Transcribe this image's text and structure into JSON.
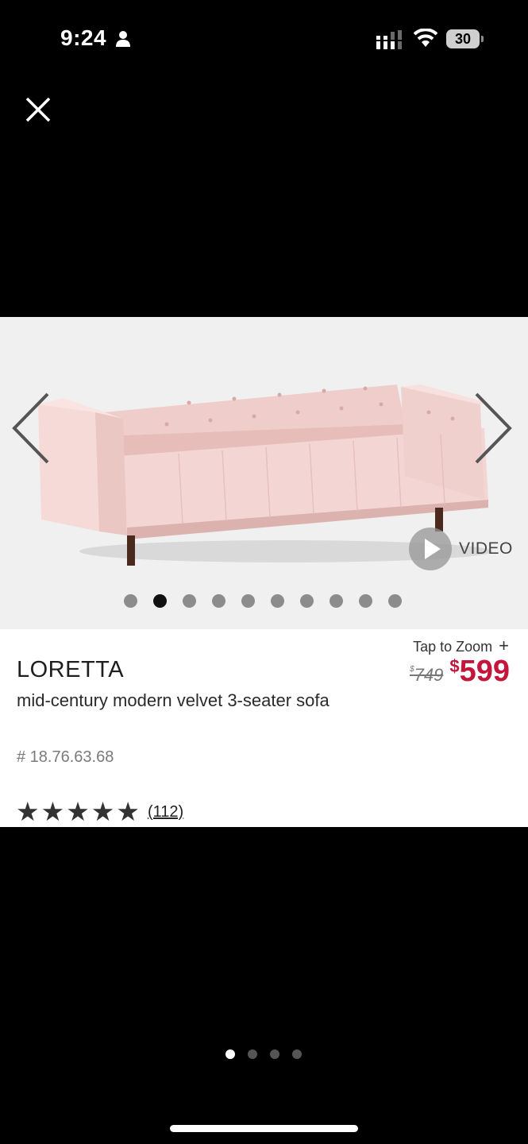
{
  "status_bar": {
    "time": "9:24",
    "battery": "30"
  },
  "product": {
    "brand": "LORETTA",
    "name": "mid-century modern velvet 3-seater sofa",
    "sku": "# 18.76.63.68",
    "original_price": "749",
    "price": "599",
    "currency_symbol": "$",
    "tap_to_zoom": "Tap to Zoom",
    "zoom_plus": "+",
    "video_label": "VIDEO",
    "rating_stars": 5,
    "review_count": "(112)",
    "star_glyph": "★"
  },
  "image_carousel": {
    "total": 10,
    "active_index": 1
  },
  "page_indicator": {
    "total": 4,
    "active_index": 0
  },
  "colors": {
    "sale_price": "#c4163b",
    "sofa": "#f2d3d0",
    "background": "#000000"
  },
  "icons": [
    "person-icon",
    "signal-icon",
    "wifi-icon",
    "close-icon",
    "chevron-left-icon",
    "chevron-right-icon",
    "play-icon",
    "star-icon"
  ]
}
